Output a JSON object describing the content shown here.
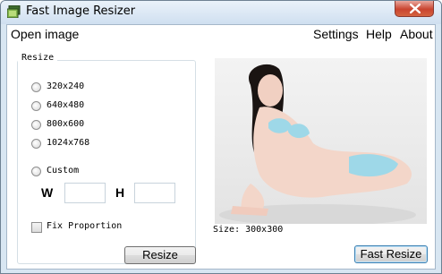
{
  "window": {
    "title": "Fast Image Resizer"
  },
  "menu": {
    "open_image": "Open image",
    "settings": "Settings",
    "help": "Help",
    "about": "About"
  },
  "resize_group": {
    "legend": "Resize",
    "options": [
      {
        "label": "320x240",
        "selected": false
      },
      {
        "label": "640x480",
        "selected": false
      },
      {
        "label": "800x600",
        "selected": false
      },
      {
        "label": "1024x768",
        "selected": false
      },
      {
        "label": "Custom",
        "selected": false
      }
    ],
    "width_label": "W",
    "height_label": "H",
    "width_value": "",
    "height_value": "",
    "fix_proportion_label": "Fix Proportion",
    "fix_proportion_checked": false
  },
  "preview": {
    "size_label": "Size:",
    "size_value": "300x300",
    "icon": "photo-preview"
  },
  "buttons": {
    "resize": "Resize",
    "fast_resize": "Fast Resize"
  },
  "colors": {
    "frame": "#d8e6f2",
    "close_button": "#c9442f",
    "default_button_border": "#3c7fb1"
  }
}
